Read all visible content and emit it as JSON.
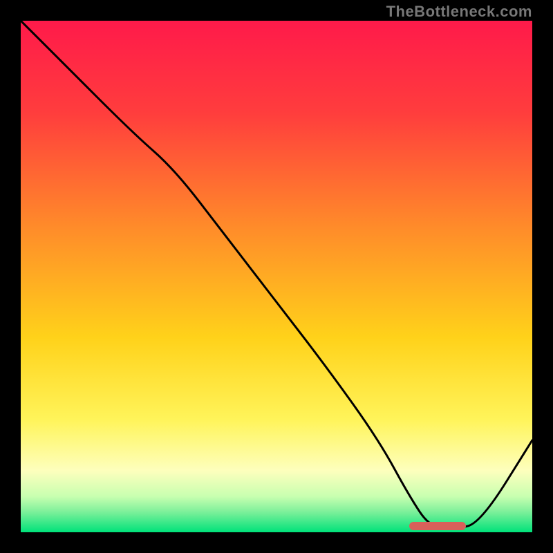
{
  "watermark": "TheBottleneck.com",
  "chart_data": {
    "type": "line",
    "title": "",
    "xlabel": "",
    "ylabel": "",
    "xlim": [
      0,
      100
    ],
    "ylim": [
      0,
      100
    ],
    "grid": false,
    "legend": false,
    "background_gradient": {
      "stops": [
        {
          "pos": 0.0,
          "color": "#ff1a4a"
        },
        {
          "pos": 0.18,
          "color": "#ff3d3d"
        },
        {
          "pos": 0.4,
          "color": "#ff8a2a"
        },
        {
          "pos": 0.62,
          "color": "#ffd21a"
        },
        {
          "pos": 0.78,
          "color": "#fff45a"
        },
        {
          "pos": 0.88,
          "color": "#fdffbd"
        },
        {
          "pos": 0.93,
          "color": "#c8ffb0"
        },
        {
          "pos": 0.96,
          "color": "#7df09a"
        },
        {
          "pos": 1.0,
          "color": "#00e27a"
        }
      ]
    },
    "series": [
      {
        "name": "bottleneck-curve",
        "color": "#000000",
        "x": [
          0,
          8,
          22,
          30,
          40,
          50,
          60,
          70,
          76,
          80,
          85,
          90,
          100
        ],
        "y": [
          100,
          92,
          78,
          71,
          58,
          45,
          32,
          18,
          7,
          1,
          0.5,
          2,
          18
        ]
      }
    ],
    "annotations": [
      {
        "name": "optimal-range-marker",
        "type": "bar",
        "color": "#d9605a",
        "x_start": 76,
        "x_end": 87,
        "y": 1.2
      }
    ]
  }
}
